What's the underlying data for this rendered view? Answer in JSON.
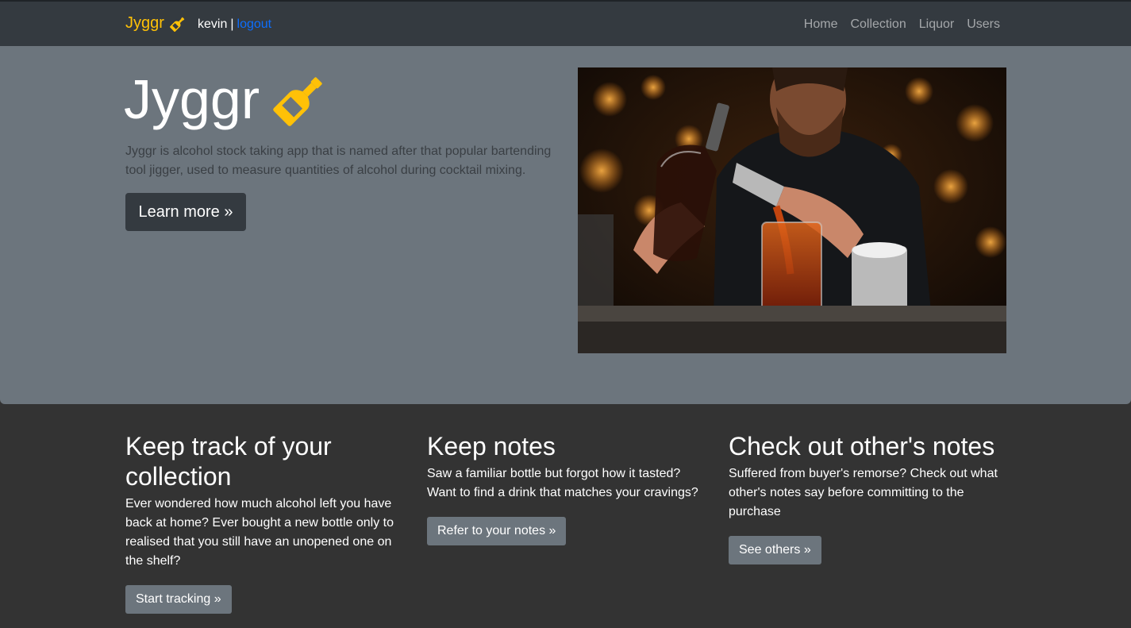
{
  "navbar": {
    "brand": "Jyggr",
    "brand_icon": "bottle-icon",
    "brand_color": "#ffc107",
    "username": "kevin",
    "separator": "|",
    "logout_label": "logout",
    "links": [
      "Home",
      "Collection",
      "Liquor",
      "Users"
    ]
  },
  "hero": {
    "title": "Jyggr",
    "description": "Jyggr is alcohol stock taking app that is named after that popular bartending tool jigger, used to measure quantities of alcohol during cocktail mixing.",
    "button_label": "Learn more »",
    "image_alt": "bartender pouring drink"
  },
  "features": [
    {
      "heading": "Keep track of your collection",
      "text": "Ever wondered how much alcohol left you have back at home? Ever bought a new bottle only to realised that you still have an unopened one on the shelf?",
      "button_label": "Start tracking »"
    },
    {
      "heading": "Keep notes",
      "text": "Saw a familiar bottle but forgot how it tasted? Want to find a drink that matches your cravings?",
      "button_label": "Refer to your notes »"
    },
    {
      "heading": "Check out other's notes",
      "text": "Suffered from buyer's remorse? Check out what other's notes say before committing to the purchase",
      "button_label": "See others »"
    }
  ]
}
